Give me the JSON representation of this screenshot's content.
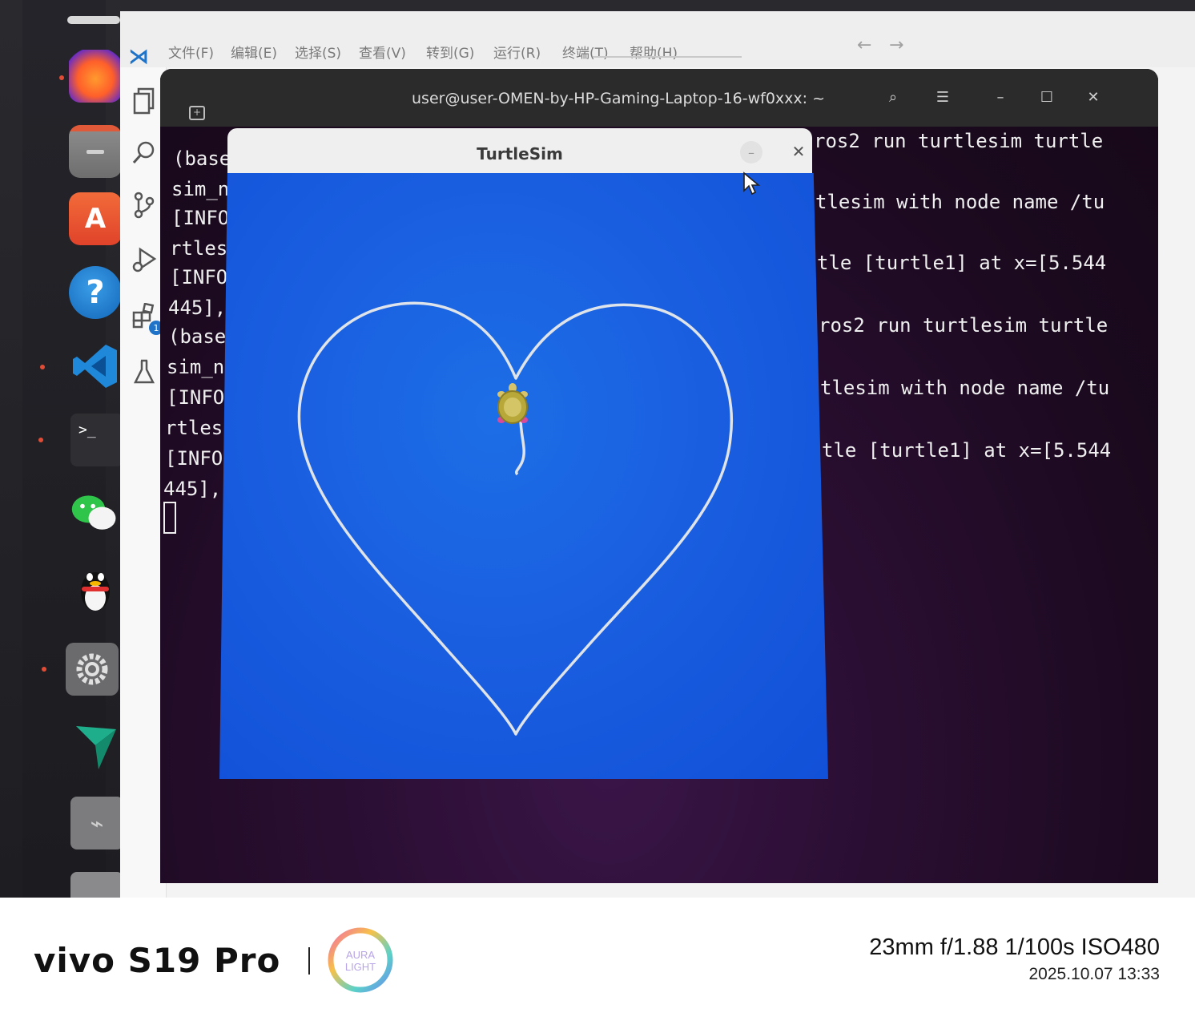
{
  "vscode": {
    "menu": [
      "文件(F)",
      "编辑(E)",
      "选择(S)",
      "查看(V)",
      "转到(G)",
      "运行(R)",
      "终端(T)",
      "帮助(H)"
    ],
    "extensions_badge": "1"
  },
  "dock": {
    "icons": [
      "firefox-icon",
      "files-icon",
      "app-center-icon",
      "help-icon",
      "vscode-icon",
      "terminal-icon",
      "wechat-icon",
      "qq-icon",
      "settings-icon",
      "feishu-icon",
      "usb-drive-icon",
      "trash-icon"
    ],
    "help_glyph": "?",
    "terminal_glyph": ">_"
  },
  "terminal": {
    "title": "user@user-OMEN-by-HP-Gaming-Laptop-16-wf0xxx: ~",
    "left_lines": [
      "(base",
      "sim_n",
      "[INFO",
      "rtles",
      "[INFO",
      "445],",
      "(base",
      "sim_n",
      "[INFO",
      "rtles",
      "[INFO",
      "445],"
    ],
    "right_lines": [
      "ros2 run turtlesim turtle",
      "tlesim with node name /tu",
      "tle [turtle1] at x=[5.544",
      "ros2 run turtlesim turtle",
      "tlesim with node name /tu",
      "tle [turtle1] at x=[5.544"
    ]
  },
  "turtlesim": {
    "title": "TurtleSim",
    "minimize_glyph": "–",
    "close_glyph": "✕",
    "background_color": "#1a5ee0",
    "pen_color": "#dfe3ea"
  },
  "watermark": {
    "brand": "vivo S19 Pro",
    "aura_line1": "AURA",
    "aura_line2": "LIGHT",
    "params": "23mm  f/1.88  1/100s  ISO480",
    "datetime": "2025.10.07 13:33"
  }
}
